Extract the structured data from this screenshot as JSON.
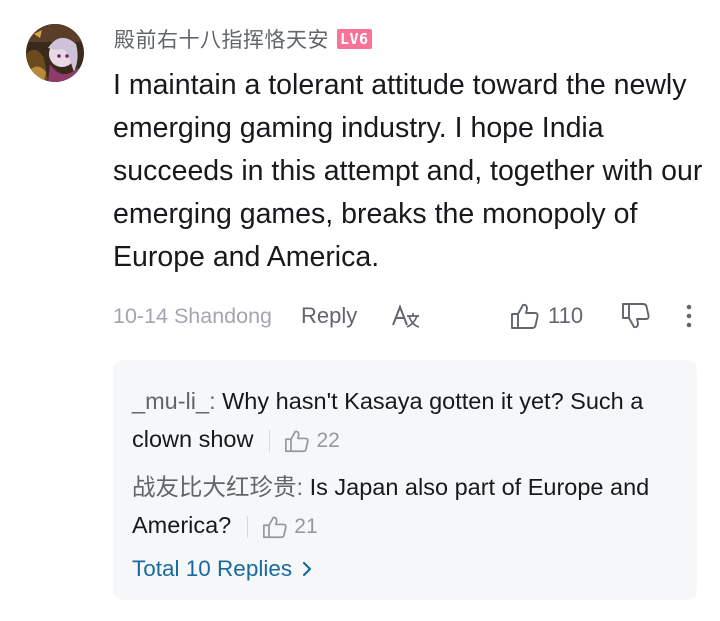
{
  "comment": {
    "username": "殿前右十八指挥恪天安",
    "level_badge": "LV6",
    "content": "I maintain a tolerant attitude toward the newly emerging gaming industry. I hope India succeeds in this attempt and, together with our emerging games, breaks the monopoly of Europe and America.",
    "date_location": "10-14 Shandong",
    "reply_label": "Reply",
    "translate_icon": "translate-icon",
    "like_count": "110",
    "like_icon": "thumbs-up-icon",
    "dislike_icon": "thumbs-down-icon",
    "more_icon": "more-vertical-icon",
    "level_color": "#fb7299"
  },
  "replies": {
    "items": [
      {
        "author": "_mu-li_",
        "text": "Why hasn't Kasaya gotten it yet? Such a clown show",
        "likes": "22"
      },
      {
        "author": "战友比大红珍贵",
        "text": "Is Japan also part of Europe and America?",
        "likes": "21"
      }
    ],
    "total_label": "Total 10 Replies",
    "link_color": "#1a6a9e"
  }
}
